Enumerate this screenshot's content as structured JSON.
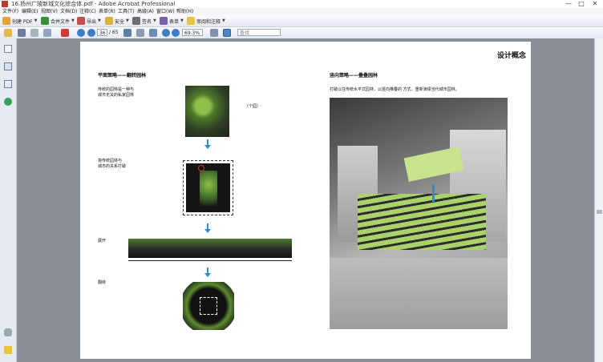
{
  "window": {
    "title": "16.扬州广陵新城文化综合体.pdf - Adobe Acrobat Professional",
    "controls": [
      "—",
      "□",
      "✕"
    ]
  },
  "menu": [
    "文件(F)",
    "编辑(E)",
    "视图(V)",
    "文档(D)",
    "注释(C)",
    "表单(R)",
    "工具(T)",
    "高级(A)",
    "窗口(W)",
    "帮助(H)"
  ],
  "toolbar1": {
    "create_pdf": "创建 PDF",
    "combine": "合并文件",
    "export": "导出",
    "secure": "安全",
    "sign": "签名",
    "forms": "表单",
    "review": "审阅和注释"
  },
  "toolbar2": {
    "current_page": "36",
    "total_pages": "/ 65",
    "zoom": "69.3%",
    "search_placeholder": "查找"
  },
  "colors": {
    "accent": "#2b8ed8",
    "page_bg": "#ffffff",
    "viewer_bg": "#8a8f96"
  },
  "page": {
    "title": "设计概念",
    "left": {
      "heading": "平面策略——翻转园林",
      "step1_text_line1": "传统的园林是一种与",
      "step1_text_line2": "城市无关的私家园林",
      "step1_tag": "（个园）",
      "step2_text_line1": "将传统园林与",
      "step2_text_line2": "城市的关系打破",
      "step3_text": "展开",
      "step4_text": "翻转"
    },
    "right": {
      "heading": "竖向策略——叠叠园林",
      "description": "打破以往传统水平式园林，以竖向推叠的 方式，重新演绎当代城市园林。"
    }
  }
}
